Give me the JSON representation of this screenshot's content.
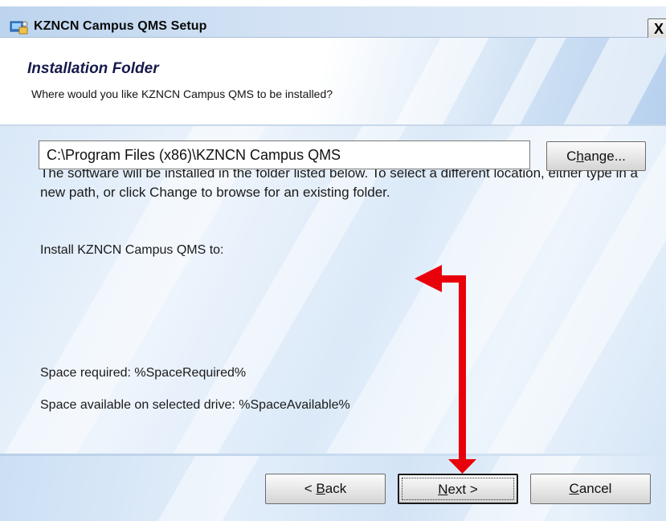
{
  "window": {
    "title": "KZNCN Campus QMS Setup",
    "close_label": "X"
  },
  "banner": {
    "title": "Installation Folder",
    "subtitle": "Where would you like KZNCN Campus QMS to be installed?"
  },
  "body": {
    "description": "The software will be installed in the folder listed below. To select a different location, either type in a new path, or click Change to browse for an existing folder.",
    "install_label": "Install KZNCN Campus QMS to:",
    "install_path": "C:\\Program Files (x86)\\KZNCN Campus QMS",
    "change_button": {
      "before": "C",
      "mnemonic": "h",
      "after": "ange..."
    },
    "space_required": "Space required: %SpaceRequired%",
    "space_available": "Space available on selected drive: %SpaceAvailable%"
  },
  "footer": {
    "back_button": {
      "before": "< ",
      "mnemonic": "B",
      "after": "ack"
    },
    "next_button": {
      "before": "",
      "mnemonic": "N",
      "after": "ext >"
    },
    "cancel_button": {
      "before": "",
      "mnemonic": "C",
      "after": "ancel"
    }
  },
  "icons": {
    "app": "setup-icon",
    "close": "close-icon",
    "annotation": "red-arrow-icon"
  },
  "colors": {
    "annotation": "#e8000b",
    "title_bar": "#d2e2f4",
    "banner_title": "#151a4a"
  }
}
